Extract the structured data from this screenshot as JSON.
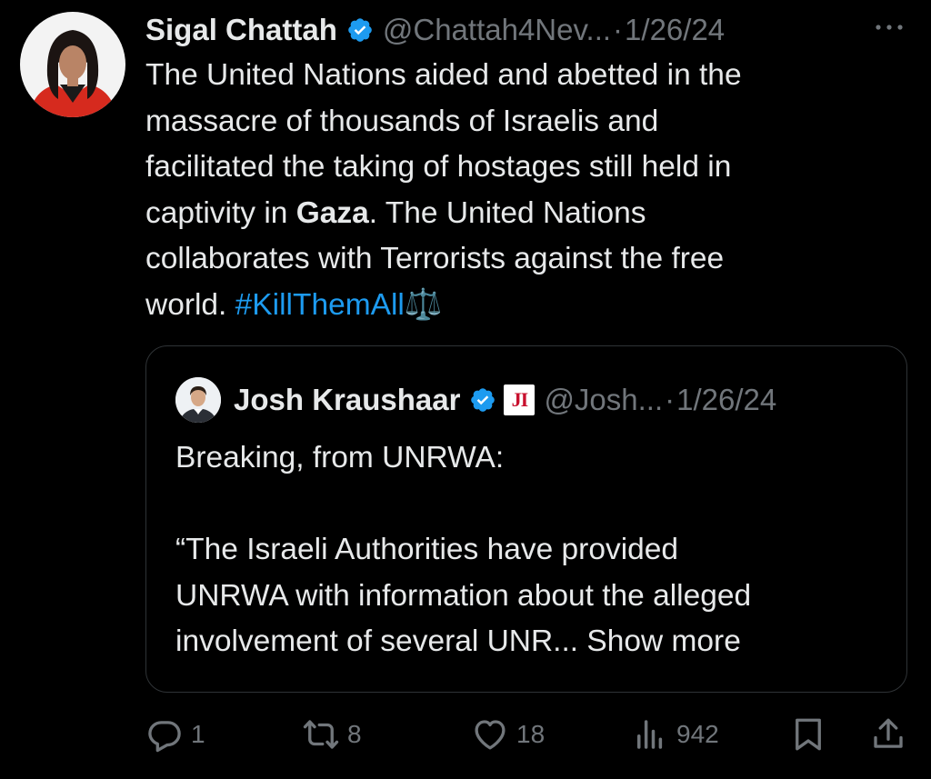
{
  "tweet": {
    "author_name": "Sigal Chattah",
    "handle": "@Chattah4Nev...",
    "separator": "·",
    "date": "1/26/24",
    "lines": [
      "The United Nations aided and abetted in the",
      "massacre of thousands of Israelis and",
      "facilitated the taking of hostages still held in"
    ],
    "line4_prefix": "captivity in ",
    "line4_bold": "Gaza",
    "line4_suffix": ". The United Nations",
    "line5": "collaborates with Terrorists against the free",
    "line6_prefix": "world. ",
    "hashtag": "#KillThemAll",
    "emoji": "⚖️"
  },
  "quoted": {
    "author_name": "Josh Kraushaar",
    "affiliate_badge": "JI",
    "handle": "@Josh...",
    "separator": "·",
    "date": "1/26/24",
    "line1": "Breaking, from UNRWA:",
    "line2": "“The Israeli Authorities have provided",
    "line3": "UNRWA with information about the alleged",
    "line4": "involvement of several UNR... Show more"
  },
  "actions": {
    "replies": "1",
    "reposts": "8",
    "likes": "18",
    "views": "942"
  },
  "colors": {
    "background": "#000000",
    "text": "#e7e9ea",
    "muted": "#71767b",
    "accent": "#1d9bf0",
    "border": "#2f3336"
  }
}
